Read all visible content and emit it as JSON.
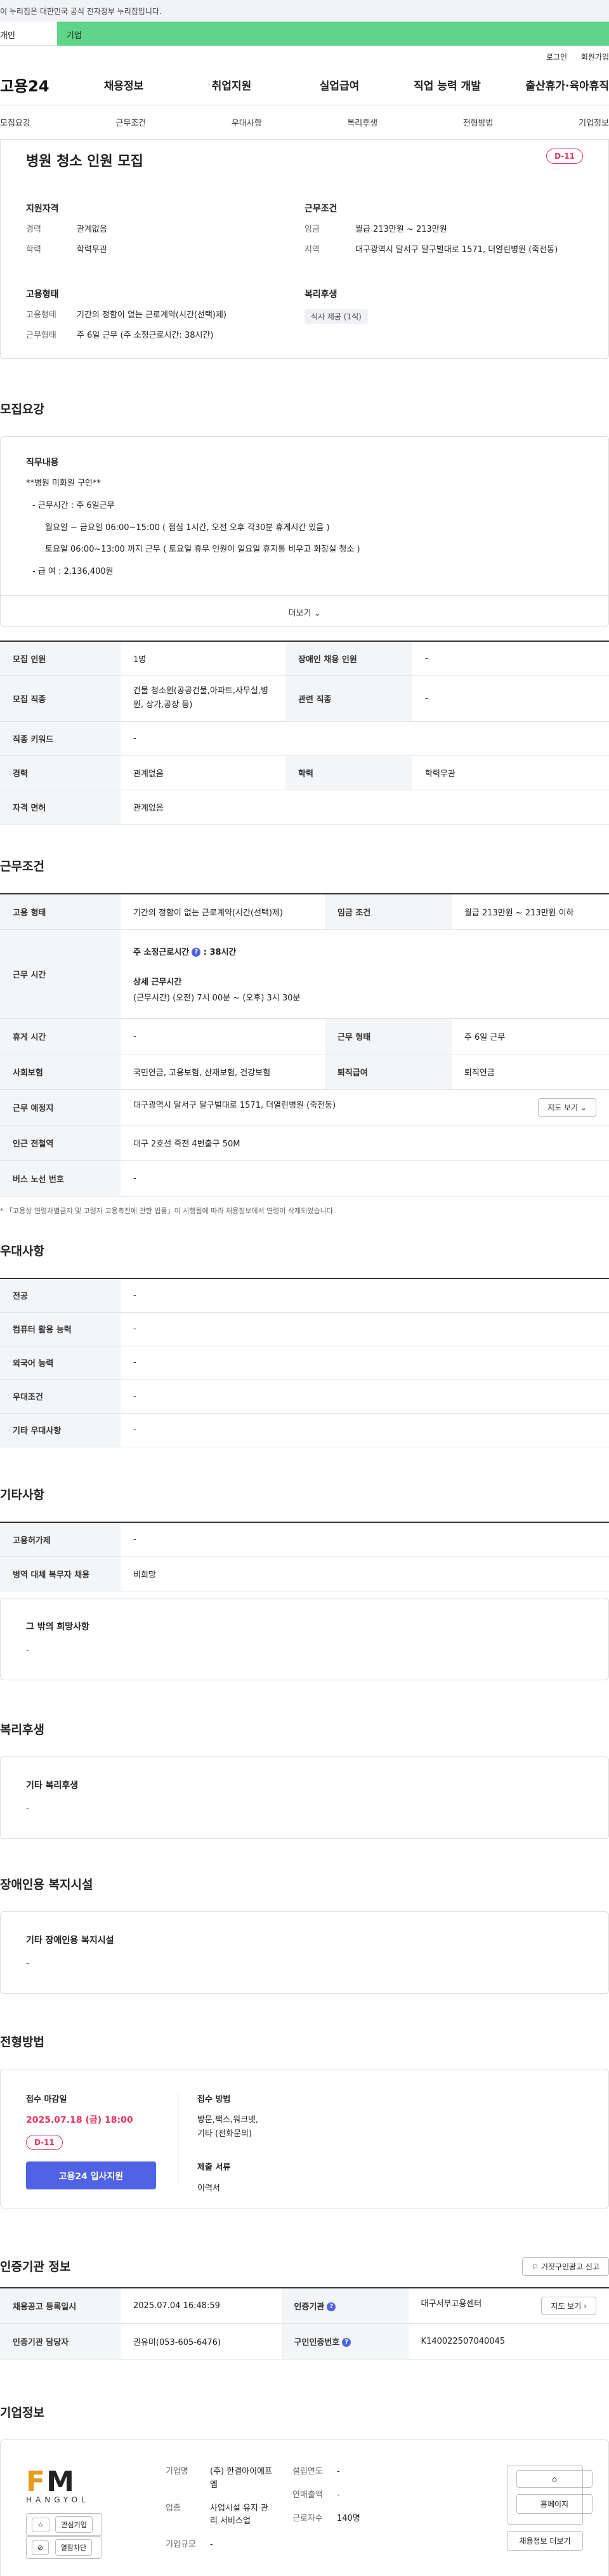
{
  "gov_notice": "이 누리집은 대한민국 공식 전자정부 누리집입니다.",
  "top_tabs": {
    "individual": "개인",
    "business": "기업"
  },
  "util": {
    "login": "로그인",
    "join": "회원가입"
  },
  "logo": "고용24",
  "gnb": [
    "채용정보",
    "취업지원",
    "실업급여",
    "직업 능력 개발",
    "출산휴가·육아휴직"
  ],
  "anchors": [
    "모집요강",
    "근무조건",
    "우대사항",
    "복리후생",
    "전형방법",
    "기업정보"
  ],
  "hero": {
    "title": "병원 청소 인원 모집",
    "dday": "D-11",
    "qual_title": "지원자격",
    "career_k": "경력",
    "career_v": "관계없음",
    "edu_k": "학력",
    "edu_v": "학력무관",
    "emp_title": "고용형태",
    "emptype_k": "고용형태",
    "emptype_v": "기간의 정함이 없는 근로계약(시간(선택)제)",
    "worktype_k": "근무형태",
    "worktype_v": "주 6일 근무 (주 소정근로시간: 38시간)",
    "cond_title": "근무조건",
    "wage_k": "임금",
    "wage_v": "월급 213만원 ~ 213만원",
    "region_k": "지역",
    "region_v": "대구광역시 달서구 달구벌대로 1571, 더열린병원 (죽전동)",
    "welfare_title": "복리후생",
    "welfare_tag": "식사 제공 (1식)"
  },
  "recruit": {
    "title": "모집요강",
    "job_label": "직무내용",
    "lines": [
      "**병원 미화원 구인**",
      "- 근무시간 : 주 6일근무",
      "월요일 ~ 금요일 06:00~15:00 ( 점심 1시간, 오전 오후 각30분 휴게시간 있음 )",
      "토요일 06:00~13:00 까지 근무 ( 토요일 휴무 인원이 일요일 휴지통 비우고 화장실 청소 )",
      "- 급      여 : 2,136,400원"
    ],
    "more": "더보기",
    "rows": {
      "count_k": "모집 인원",
      "count_v": "1명",
      "disabled_k": "장애인 채용 인원",
      "disabled_v": "-",
      "job_k": "모집 직종",
      "job_v": "건물 청소원(공공건물,아파트,사무실,병원, 상가,공장 등)",
      "related_k": "관련 직종",
      "related_v": "-",
      "keyword_k": "직종 키워드",
      "keyword_v": "-",
      "career_k": "경력",
      "career_v": "관계없음",
      "edu_k": "학력",
      "edu_v": "학력무관",
      "license_k": "자격 면허",
      "license_v": "관계없음"
    }
  },
  "conditions": {
    "title": "근무조건",
    "emptype_k": "고용 형태",
    "emptype_v": "기간의 정함이 없는 근로계약(시간(선택)제)",
    "wage_k": "임금 조건",
    "wage_v": "월급 213만원 ~ 213만원 이하",
    "hours_k": "근무 시간",
    "hours_label": "주 소정근로시간",
    "hours_value": ": 38시간",
    "detail_label": "상세 근무시간",
    "detail_value": "(근무시간) (오전) 7시 00분 ~ (오후) 3시 30분",
    "rest_k": "휴게 시간",
    "rest_v": "-",
    "form_k": "근무 형태",
    "form_v": "주 6일 근무",
    "insurance_k": "사회보험",
    "insurance_v": "국민연금, 고용보험, 산재보험, 건강보험",
    "severance_k": "퇴직급여",
    "severance_v": "퇴직연금",
    "place_k": "근무 예정지",
    "place_v": "대구광역시 달서구 달구벌대로 1571, 더열린병원 (죽전동)",
    "map_btn": "지도 보기",
    "subway_k": "인근 전철역",
    "subway_v": "대구 2호선 죽전 4번출구 50M",
    "bus_k": "버스 노선 번호",
    "bus_v": "-",
    "note": "* 「고용상 연령차별금지 및 고령자 고용촉진에 관한 법률」이 시행됨에 따라 채용정보에서 연령이 삭제되었습니다."
  },
  "prefer": {
    "title": "우대사항",
    "major_k": "전공",
    "major_v": "-",
    "computer_k": "컴퓨터 활용 능력",
    "computer_v": "-",
    "lang_k": "외국어 능력",
    "lang_v": "-",
    "cond_k": "우대조건",
    "cond_v": "-",
    "etc_k": "기타 우대사항",
    "etc_v": "-"
  },
  "etc": {
    "title": "기타사항",
    "permit_k": "고용허가제",
    "permit_v": "-",
    "military_k": "병역 대체 복무자 채용",
    "military_v": "비희망",
    "other_label": "그 밖의 희망사항",
    "other_v": "-"
  },
  "welfare": {
    "title": "복리후생",
    "label": "기타 복리후생",
    "value": "-"
  },
  "facility": {
    "title": "장애인용 복지시설",
    "label": "기타 장애인용 복지시설",
    "value": "-"
  },
  "apply": {
    "title": "전형방법",
    "deadline_label": "접수 마감일",
    "deadline": "2025.07.18 (금) 18:00",
    "dday": "D-11",
    "apply_btn": "고용24 입사지원",
    "method_label": "접수 방법",
    "method_v": "방문,팩스,워크넷,\n기타 (전화문의)",
    "docs_label": "제출 서류",
    "docs_v": "이력서"
  },
  "agency": {
    "title": "인증기관 정보",
    "report_btn": "거짓구인광고 신고",
    "reg_k": "채용공고 등록일시",
    "reg_v": "2025.07.04 16:48:59",
    "org_k": "인증기관",
    "org_v": "대구서부고용센터",
    "map_btn": "지도 보기",
    "manager_k": "인증기관 담당자",
    "manager_v": "권유미(053-605-6476)",
    "id_k": "구인인증번호",
    "id_v": "K140022507040045"
  },
  "company": {
    "title": "기업정보",
    "logo_main_f": "F",
    "logo_main_m": "M",
    "logo_sub": "HANGYOL",
    "fav_btn": "관심기업",
    "block_btn": "열람차단",
    "name_k": "기업명",
    "name_v": "(주) 한결아이에프엠",
    "est_k": "설립연도",
    "est_v": "-",
    "industry_k": "업종",
    "industry_v": "사업시설 유지 관리 서비스업",
    "sales_k": "연매출액",
    "sales_v": "-",
    "workers_k": "근로자수",
    "workers_v": "140명",
    "size_k": "기업규모",
    "size_v": "-",
    "homepage_btn": "홈페이지",
    "jobs_btn": "채용정보 더보기"
  },
  "colors": {
    "accent": "#4f63e4",
    "dday": "#e4345a",
    "business_tab": "#5ed589"
  }
}
